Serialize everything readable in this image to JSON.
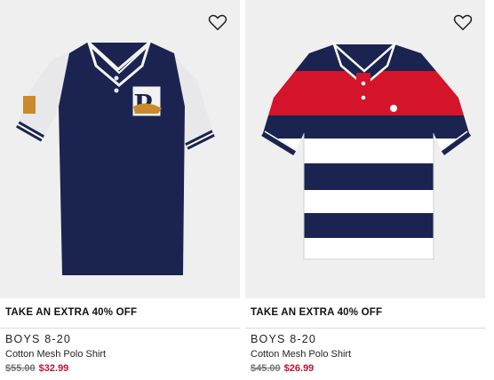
{
  "products": [
    {
      "promo": "TAKE AN EXTRA 40% OFF",
      "category": "BOYS 8-20",
      "title": "Cotton Mesh Polo Shirt",
      "original_price": "$55.00",
      "sale_price": "$32.99",
      "image_icon": "navy-raglan-polo-shirt",
      "colors": {
        "body": "#1b2450",
        "sleeve": "#e8e8ea",
        "trim": "#ffffff"
      }
    },
    {
      "promo": "TAKE AN EXTRA 40% OFF",
      "category": "BOYS 8-20",
      "title": "Cotton Mesh Polo Shirt",
      "original_price": "$45.00",
      "sale_price": "$26.99",
      "image_icon": "striped-polo-shirt",
      "colors": {
        "navy": "#1b2450",
        "red": "#d4142a",
        "white": "#ffffff"
      }
    }
  ],
  "ui": {
    "wishlist_icon": "heart-outline-icon",
    "sale_color": "#c8102e"
  }
}
